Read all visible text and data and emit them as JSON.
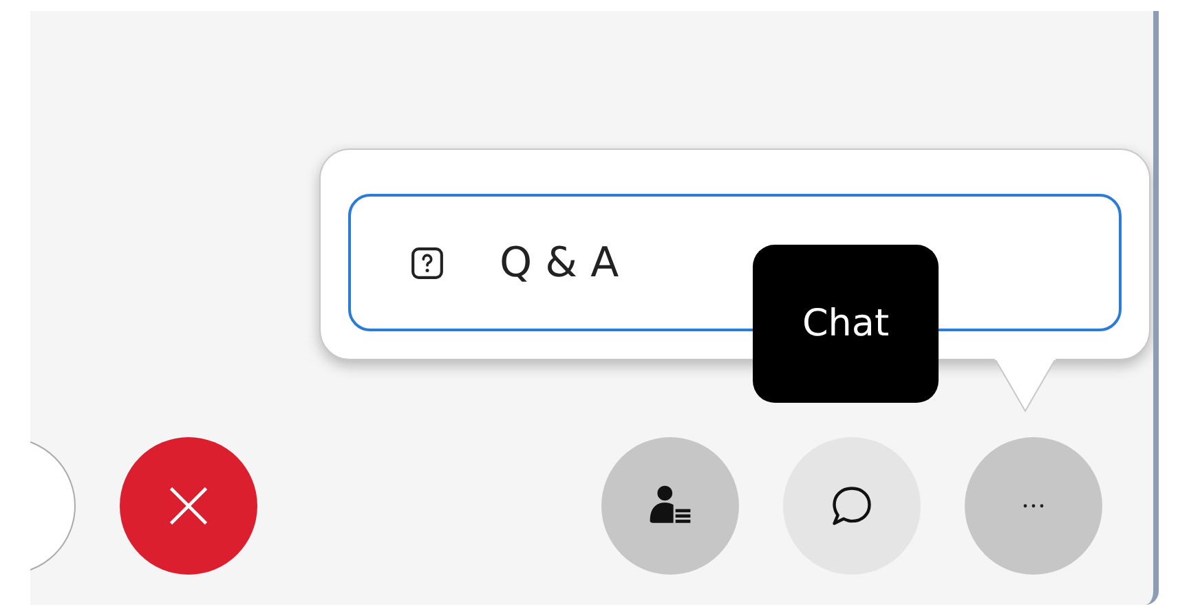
{
  "menu": {
    "items": [
      {
        "label": "Q & A",
        "selected": true
      }
    ]
  },
  "tooltip": {
    "text": "Chat"
  },
  "left_controls": [
    {
      "kind": "partial"
    },
    {
      "kind": "leave"
    }
  ],
  "right_controls": [
    {
      "kind": "participants",
      "highlighted": false
    },
    {
      "kind": "chat",
      "highlighted": true
    },
    {
      "kind": "more",
      "highlighted": false
    }
  ]
}
